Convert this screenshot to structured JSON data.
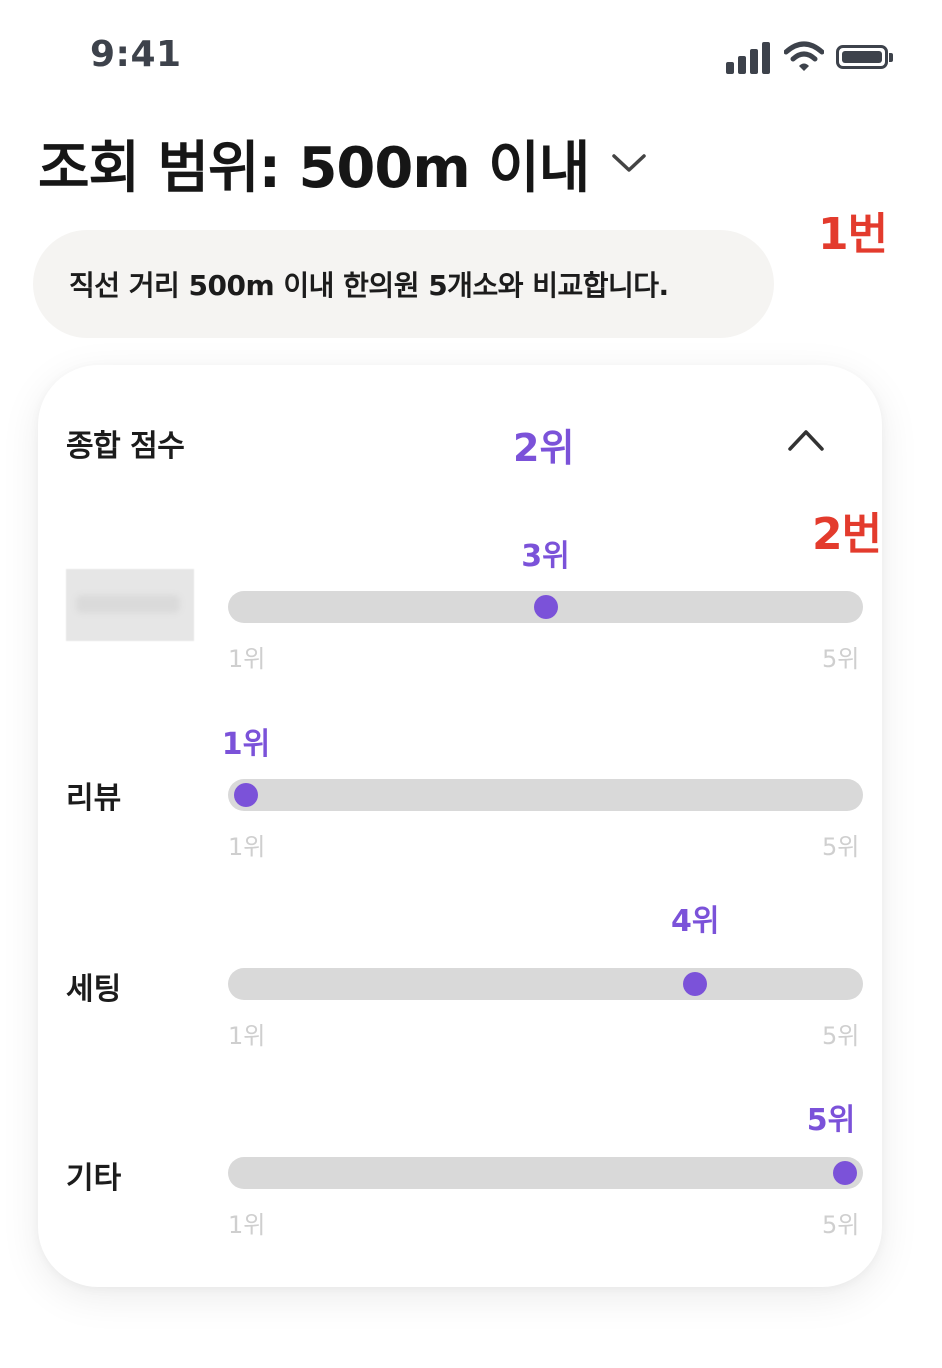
{
  "status_bar": {
    "time": "9:41",
    "icons": [
      "signal-icon",
      "wifi-icon",
      "battery-icon"
    ],
    "color": "#3d424b"
  },
  "header": {
    "title": "조회 범위: 500m 이내",
    "chevron_icon": "chevron-down-icon"
  },
  "annotations": {
    "first": "1번",
    "second": "2번",
    "color": "#e33b2d"
  },
  "info": {
    "text": "직선 거리 500m 이내 한의원 5개소와 비교합니다."
  },
  "card": {
    "header_label": "종합 점수",
    "header_rank": "2위",
    "collapse_icon": "chevron-up-icon",
    "accent_color": "#7b52d9",
    "scale_min": "1위",
    "scale_max": "5위",
    "total_ranks": 5,
    "metrics": [
      {
        "label": "",
        "rank_text": "3위",
        "rank": 3
      },
      {
        "label": "리뷰",
        "rank_text": "1위",
        "rank": 1
      },
      {
        "label": "세팅",
        "rank_text": "4위",
        "rank": 4
      },
      {
        "label": "기타",
        "rank_text": "5위",
        "rank": 5
      }
    ]
  }
}
